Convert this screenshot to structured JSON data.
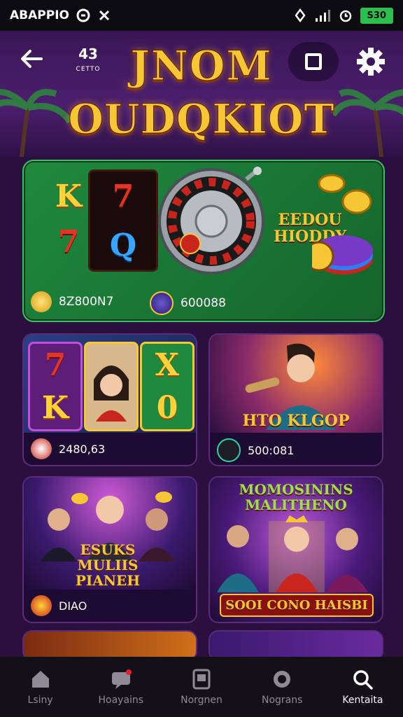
{
  "status_bar": {
    "app_label": "ABAPPIO",
    "battery": "S30"
  },
  "header": {
    "title_line1": "JNOM",
    "title_line2": "OUDQKIOT",
    "badge_number": "43",
    "badge_caption": "CETTO"
  },
  "banner": {
    "reel_symbols": [
      "K",
      "7",
      "7",
      "Q"
    ],
    "sign_text": "EEDOU HIODDY",
    "stat1": "8Z800N7",
    "stat2": "600088"
  },
  "cards": [
    {
      "symbols": [
        "7",
        "X",
        "K",
        "0"
      ],
      "value": "2480,63"
    },
    {
      "caption": "HTO KLGOP",
      "value": "500:081"
    },
    {
      "caption": "ESUKS MULIIS PIANEH",
      "value": "DIAO"
    },
    {
      "caption_top": "MOMOSININS MALITHENO",
      "caption_bottom": "SOOI CONO HAISBI"
    }
  ],
  "bottom_nav": [
    {
      "label": "Lsiny",
      "icon": "home-icon"
    },
    {
      "label": "Hoayains",
      "icon": "chat-icon"
    },
    {
      "label": "Norgnen",
      "icon": "tablet-icon"
    },
    {
      "label": "Nograns",
      "icon": "badge-icon"
    },
    {
      "label": "Kentaita",
      "icon": "search-icon",
      "active": true
    }
  ],
  "colors": {
    "background": "#2a0f3f",
    "title_gold": "#f7c634",
    "banner_green": "#1f8a3e",
    "nav_bg": "#131018"
  }
}
